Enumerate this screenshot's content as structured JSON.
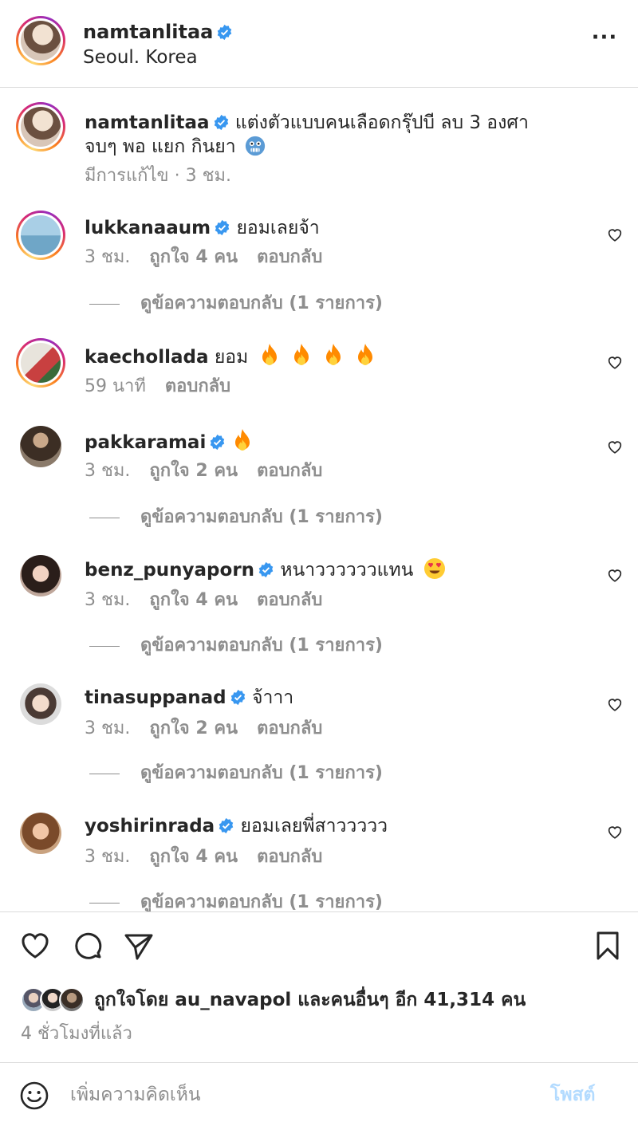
{
  "header": {
    "username": "namtanlitaa",
    "location": "Seoul. Korea",
    "more_label": "···"
  },
  "caption": {
    "username": "namtanlitaa",
    "text": "แต่งตัวแบบคนเลือดกรุ๊ปบี ลบ 3 องศา",
    "text2": "จบๆ พอ แยก กินยา",
    "edited": "มีการแก้ไข · 3 ชม."
  },
  "comments": [
    {
      "username": "lukkanaaum",
      "verified": true,
      "text": "ยอมเลยจ้า",
      "time": "3 ชม.",
      "likes": "ถูกใจ 4 คน",
      "reply": "ตอบกลับ",
      "replies": "ดูข้อความตอบกลับ (1 รายการ)"
    },
    {
      "username": "kaechollada",
      "verified": false,
      "text": "ยอม",
      "time": "59 นาที",
      "reply": "ตอบกลับ"
    },
    {
      "username": "pakkaramai",
      "verified": true,
      "text": "",
      "time": "3 ชม.",
      "likes": "ถูกใจ 2 คน",
      "reply": "ตอบกลับ",
      "replies": "ดูข้อความตอบกลับ (1 รายการ)"
    },
    {
      "username": "benz_punyaporn",
      "verified": true,
      "text": "หนาววววววแทน",
      "time": "3 ชม.",
      "likes": "ถูกใจ 4 คน",
      "reply": "ตอบกลับ",
      "replies": "ดูข้อความตอบกลับ (1 รายการ)"
    },
    {
      "username": "tinasuppanad",
      "verified": true,
      "text": "จ้าาา",
      "time": "3 ชม.",
      "likes": "ถูกใจ 2 คน",
      "reply": "ตอบกลับ",
      "replies": "ดูข้อความตอบกลับ (1 รายการ)"
    },
    {
      "username": "yoshirinrada",
      "verified": true,
      "text": "ยอมเลยพี่สาววววว",
      "time": "3 ชม.",
      "likes": "ถูกใจ 4 คน",
      "reply": "ตอบกลับ",
      "replies": "ดูข้อความตอบกลับ (1 รายการ)"
    }
  ],
  "footer": {
    "likes_text": "ถูกใจโดย au_navapol และคนอื่นๆ อีก 41,314 คน",
    "time_ago": "4 ชั่วโมงที่แล้ว",
    "comment_placeholder": "เพิ่มความคิดเห็น",
    "post_label": "โพสต์"
  },
  "colors": {
    "verified": "#3897f0",
    "text": "#262626",
    "secondary": "#8e8e8e",
    "post_disabled": "#b3dbff",
    "fire": "#ff8a00"
  }
}
